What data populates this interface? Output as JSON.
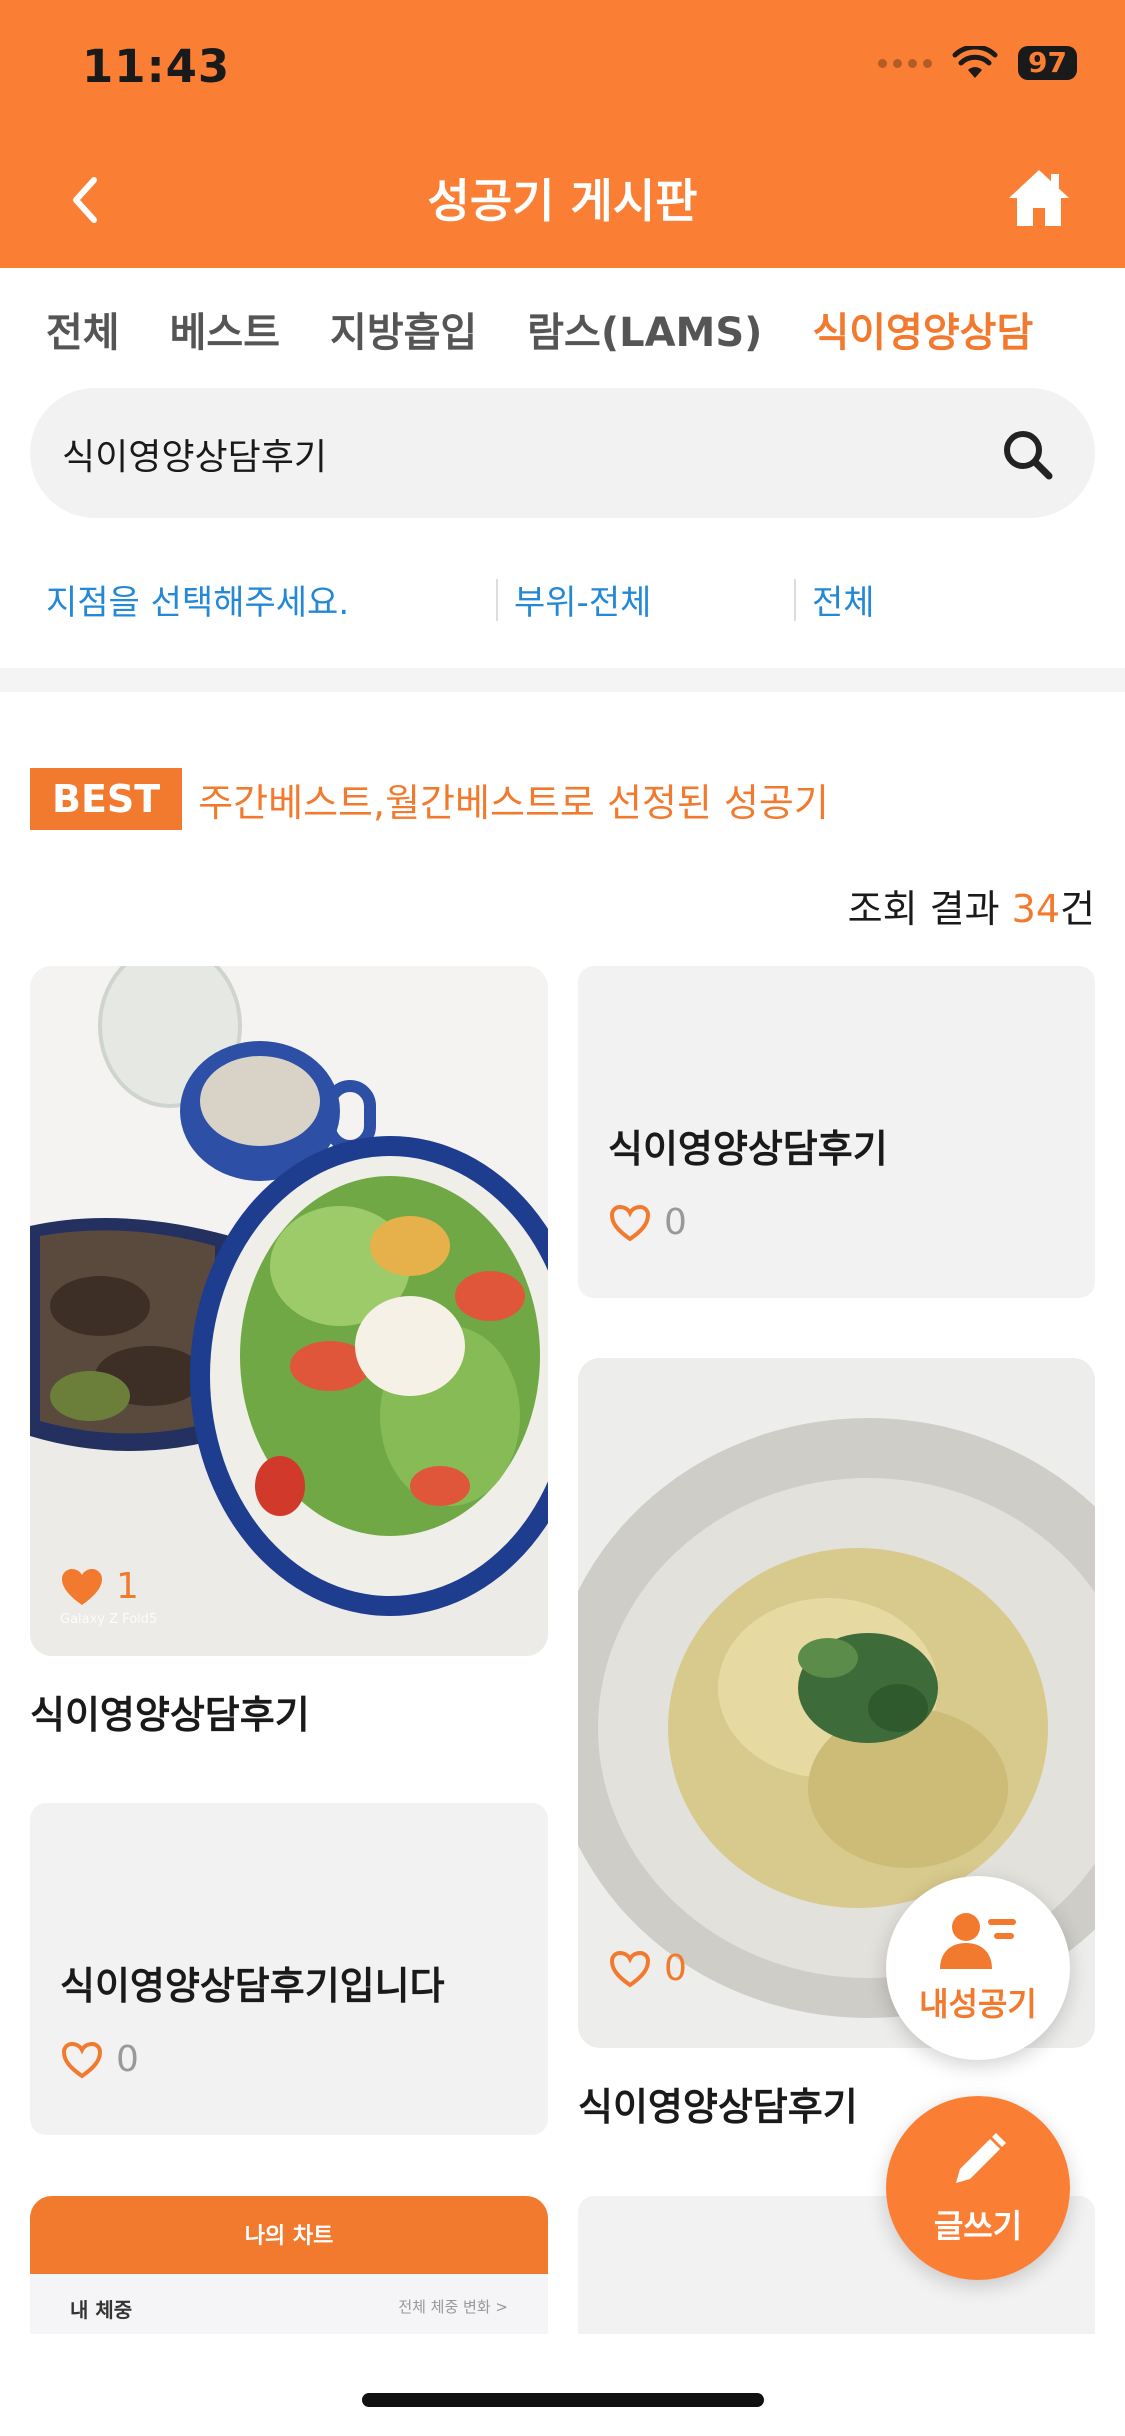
{
  "status_bar": {
    "time": "11:43",
    "battery": "97"
  },
  "nav": {
    "title": "성공기 게시판"
  },
  "tabs": [
    {
      "label": "전체",
      "active": false
    },
    {
      "label": "베스트",
      "active": false
    },
    {
      "label": "지방흡입",
      "active": false
    },
    {
      "label": "람스(LAMS)",
      "active": false
    },
    {
      "label": "식이영양상담",
      "active": true
    }
  ],
  "search": {
    "value": "식이영양상담후기"
  },
  "filters": {
    "branch": "지점을 선택해주세요.",
    "part": "부위-전체",
    "type": "전체"
  },
  "best": {
    "badge": "BEST",
    "description": "주간베스트,월간베스트로 선정된 성공기"
  },
  "results": {
    "prefix": "조회 결과 ",
    "count": "34",
    "suffix": "건"
  },
  "cards": {
    "left_photo": {
      "title": "식이영양상담후기",
      "likes": "1",
      "watermark": "Galaxy Z Fold5"
    },
    "right_text": {
      "title": "식이영양상담후기",
      "likes": "0"
    },
    "right_photo": {
      "title": "식이영양상담후기",
      "likes": "0"
    },
    "left_text": {
      "title": "식이영양상담후기입니다",
      "likes": "0"
    },
    "left_partial": {
      "header": "나의 차트",
      "row_label": "내 체중",
      "row_link": "전체 체중 변화 >"
    }
  },
  "fab": {
    "my_story": "내성공기",
    "write": "글쓰기"
  },
  "colors": {
    "primary": "#FA7F35",
    "accent_text": "#F27A2F",
    "link": "#2388D6"
  }
}
